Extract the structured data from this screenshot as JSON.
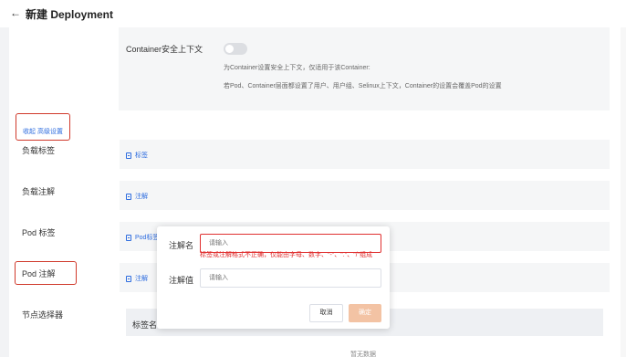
{
  "header": {
    "back_icon": "arrow-left-icon",
    "title": "新建 Deployment"
  },
  "security_context": {
    "label": "Container安全上下文",
    "toggle_state": "off",
    "description_1": "为Container设置安全上下文，仅适用于该Container:",
    "description_2": "若Pod、Container层面都设置了用户、用户组、Selinux上下文，Container的设置会覆盖Pod的设置"
  },
  "advanced": {
    "collapse_label": "收起 高级设置"
  },
  "form": {
    "workload_labels": {
      "label": "负载标签",
      "link": "标签"
    },
    "workload_annotations": {
      "label": "负载注解",
      "link": "注解"
    },
    "pod_labels": {
      "label": "Pod 标签",
      "link": "Pod标签"
    },
    "pod_annotations": {
      "label": "Pod 注解",
      "link": "注解"
    },
    "node_selector": {
      "label": "节点选择器"
    }
  },
  "table": {
    "header_name": "标签名",
    "empty_text": "暂无数据"
  },
  "popover": {
    "name_label": "注解名",
    "name_placeholder": "请输入",
    "error_text": "标签或注解格式不正确，仅能由字母、数字、\"-\"、\".\"、\"/\"组成",
    "value_label": "注解值",
    "value_placeholder": "请输入",
    "cancel_label": "取消",
    "confirm_label": "确定"
  },
  "colors": {
    "link": "#2d6cdf",
    "error": "#e03030",
    "highlight": "#d0392b",
    "confirm_disabled": "#f3c3a4"
  }
}
